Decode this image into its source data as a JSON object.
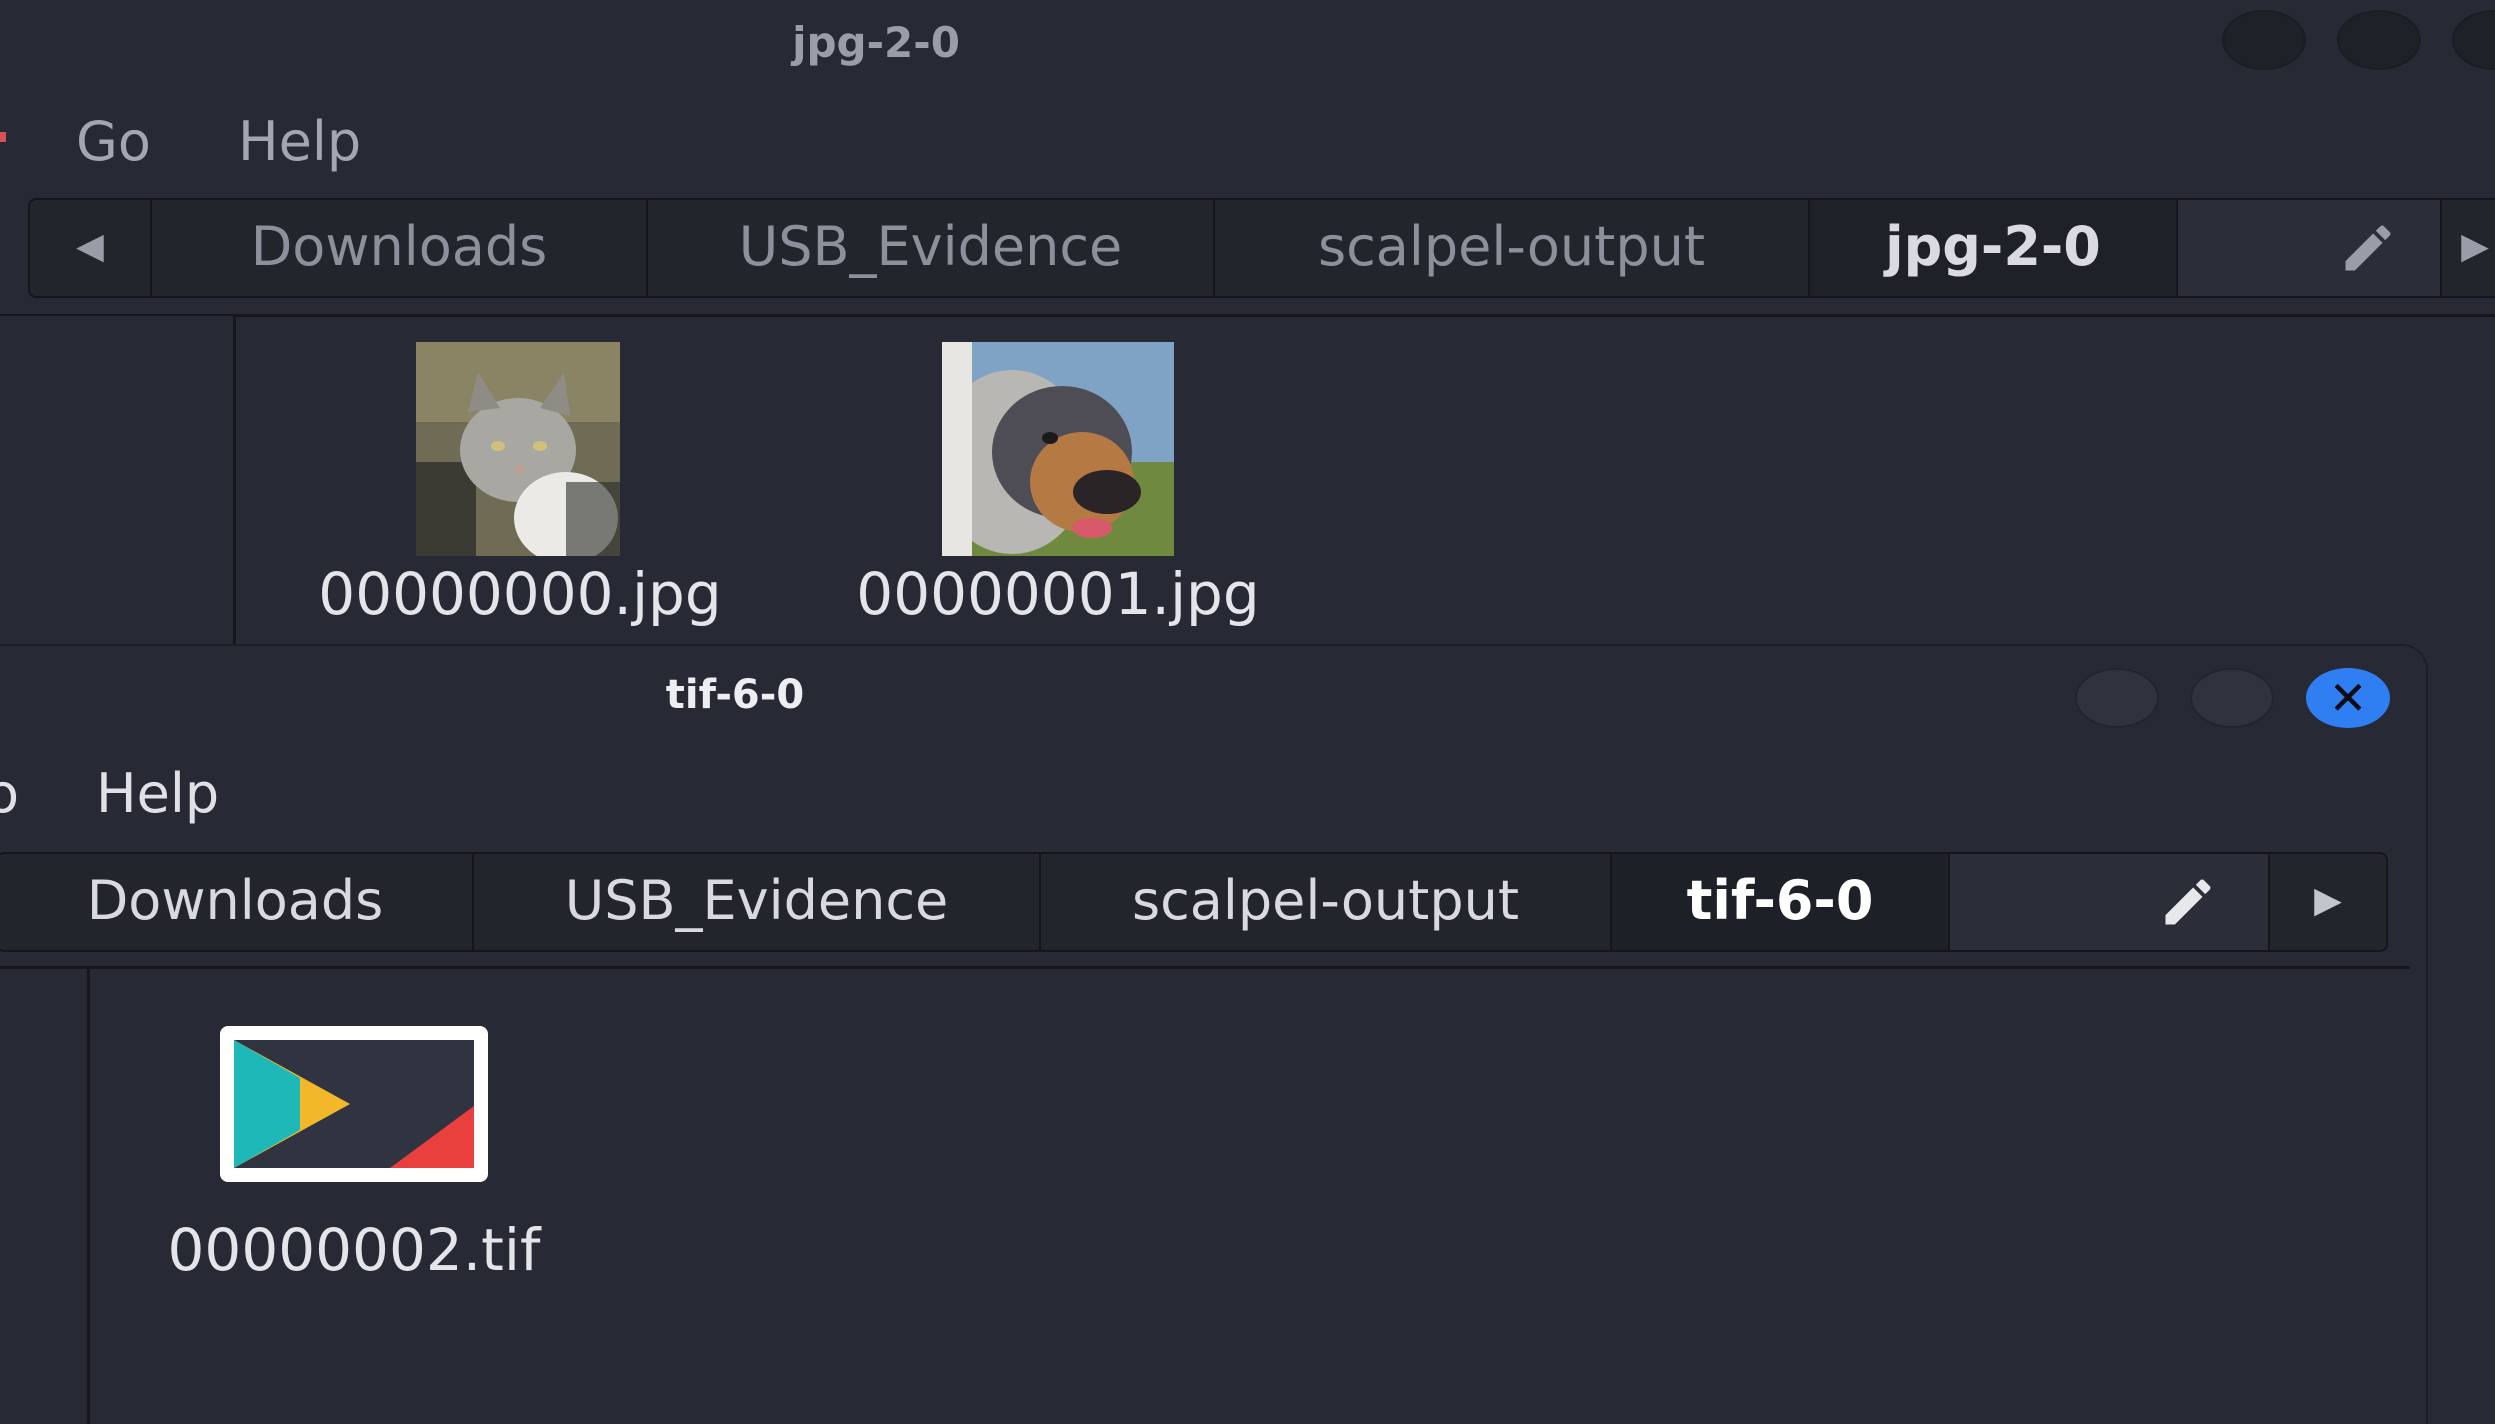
{
  "back_window": {
    "title": "jpg-2-0",
    "menu": [
      "Go",
      "Help"
    ],
    "path": [
      "Downloads",
      "USB_Evidence",
      "scalpel-output",
      "jpg-2-0"
    ],
    "files": [
      {
        "name": "00000000.jpg",
        "thumb": "cat-photo"
      },
      {
        "name": "00000001.jpg",
        "thumb": "dog-photo"
      }
    ]
  },
  "front_window": {
    "title": "tif-6-0",
    "menu": [
      "o",
      "Help"
    ],
    "path": [
      "Downloads",
      "USB_Evidence",
      "scalpel-output",
      "tif-6-0"
    ],
    "files": [
      {
        "name": "00000002.tif",
        "thumb": "app-logo-image"
      }
    ]
  },
  "icons": {
    "back_arrow": "◀",
    "forward_arrow": "▶",
    "close": "✕",
    "edit": "pencil-icon"
  },
  "colors": {
    "accent": "#2f7ef2",
    "background": "#272a34"
  }
}
